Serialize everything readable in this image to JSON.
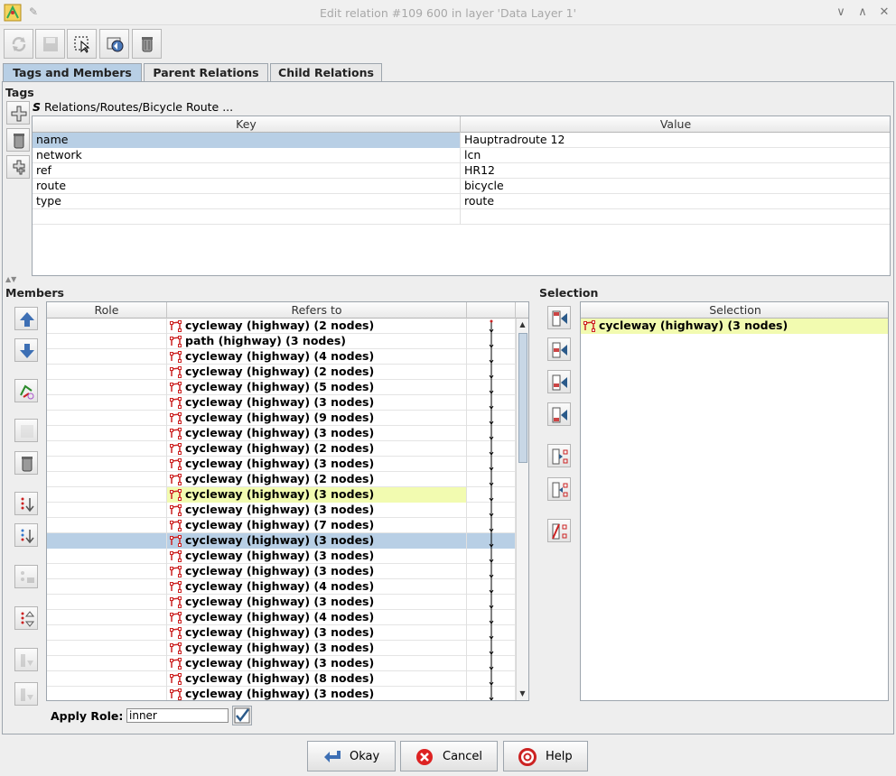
{
  "window": {
    "title": "Edit relation #109 600 in layer 'Data Layer 1'",
    "minimize_glyph": "∨",
    "maximize_glyph": "∧",
    "close_glyph": "✕"
  },
  "toolbar": {
    "buttons": [
      "refresh",
      "save",
      "select",
      "zoom-to",
      "delete"
    ]
  },
  "tabs": [
    {
      "label": "Tags and Members",
      "active": true
    },
    {
      "label": "Parent Relations",
      "active": false
    },
    {
      "label": "Child Relations",
      "active": false
    }
  ],
  "tags": {
    "section_label": "Tags",
    "preset": "Relations/Routes/Bicycle Route ...",
    "columns": {
      "key": "Key",
      "value": "Value"
    },
    "rows": [
      {
        "key": "name",
        "value": "Hauptradroute 12"
      },
      {
        "key": "network",
        "value": "lcn"
      },
      {
        "key": "ref",
        "value": "HR12"
      },
      {
        "key": "route",
        "value": "bicycle"
      },
      {
        "key": "type",
        "value": "route"
      }
    ]
  },
  "members": {
    "section_label": "Members",
    "columns": {
      "role": "Role",
      "refers_to": "Refers to"
    },
    "rows": [
      {
        "role": "",
        "refers": "cycleway (highway) (2 nodes)"
      },
      {
        "role": "",
        "refers": "path (highway) (3 nodes)"
      },
      {
        "role": "",
        "refers": "cycleway (highway) (4 nodes)"
      },
      {
        "role": "",
        "refers": "cycleway (highway) (2 nodes)"
      },
      {
        "role": "",
        "refers": "cycleway (highway) (5 nodes)"
      },
      {
        "role": "",
        "refers": "cycleway (highway) (3 nodes)"
      },
      {
        "role": "",
        "refers": "cycleway (highway) (9 nodes)"
      },
      {
        "role": "",
        "refers": "cycleway (highway) (3 nodes)"
      },
      {
        "role": "",
        "refers": "cycleway (highway) (2 nodes)"
      },
      {
        "role": "",
        "refers": "cycleway (highway) (3 nodes)"
      },
      {
        "role": "",
        "refers": "cycleway (highway) (2 nodes)"
      },
      {
        "role": "",
        "refers": "cycleway (highway) (3 nodes)"
      },
      {
        "role": "",
        "refers": "cycleway (highway) (3 nodes)"
      },
      {
        "role": "",
        "refers": "cycleway (highway) (7 nodes)"
      },
      {
        "role": "",
        "refers": "cycleway (highway) (3 nodes)"
      },
      {
        "role": "",
        "refers": "cycleway (highway) (3 nodes)"
      },
      {
        "role": "",
        "refers": "cycleway (highway) (3 nodes)"
      },
      {
        "role": "",
        "refers": "cycleway (highway) (4 nodes)"
      },
      {
        "role": "",
        "refers": "cycleway (highway) (3 nodes)"
      },
      {
        "role": "",
        "refers": "cycleway (highway) (4 nodes)"
      },
      {
        "role": "",
        "refers": "cycleway (highway) (3 nodes)"
      },
      {
        "role": "",
        "refers": "cycleway (highway) (3 nodes)"
      },
      {
        "role": "",
        "refers": "cycleway (highway) (3 nodes)"
      },
      {
        "role": "",
        "refers": "cycleway (highway) (8 nodes)"
      },
      {
        "role": "",
        "refers": "cycleway (highway) (3 nodes)"
      }
    ],
    "highlighted_index": 11,
    "selected_index": 14,
    "apply_role_label": "Apply Role:",
    "apply_role_value": "inner"
  },
  "selection": {
    "section_label": "Selection",
    "column": "Selection",
    "rows": [
      "cycleway (highway) (3 nodes)"
    ]
  },
  "dialog_buttons": {
    "okay": "Okay",
    "cancel": "Cancel",
    "help": "Help"
  }
}
